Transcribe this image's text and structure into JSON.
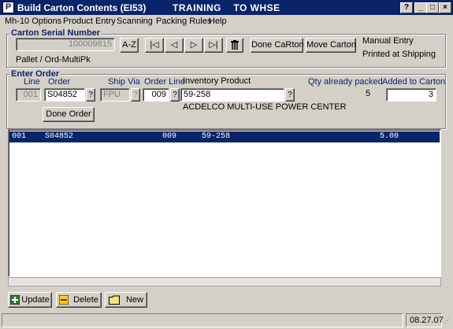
{
  "window": {
    "title": "Build Carton Contents (EI53)",
    "mode": "TRAINING    TO WHSE",
    "icon_letter": "P",
    "controls": {
      "help": "?",
      "minimize": "_",
      "maximize": "□",
      "close": "×"
    }
  },
  "menu": [
    "Mh-10 Options",
    "Product Entry",
    "Scanning",
    "Packing Rules",
    "Help"
  ],
  "carton": {
    "group_label": "Carton Serial Number",
    "serial": "100009815",
    "az_label": "A-Z",
    "nav": {
      "first": "|◁",
      "prev": "◁",
      "next": "▷",
      "last": "▷|",
      "delete": "trash-icon"
    },
    "done_label": "Done CaRton",
    "move_label": "Move Carton",
    "manual_entry": "Manual Entry",
    "printed_at": "Printed at Shipping",
    "pallet": "Pallet / Ord-MultiPk"
  },
  "order": {
    "group_label": "Enter Order",
    "headers": {
      "line": "Line",
      "order": "Order",
      "ship_via": "Ship Via",
      "order_line": "Order Line",
      "inventory_product": "Inventory Product",
      "qty_packed": "Qty already packed",
      "added": "Added to Carton"
    },
    "line": "001",
    "order_no": "S04852",
    "ship_via": "FPU",
    "order_line": "009",
    "product": "59-258",
    "qty_packed": "5",
    "added": "3",
    "description": "ACDELCO MULTI-USE POWER CENTER",
    "lookup": "?",
    "done_order_label": "Done Order"
  },
  "grid": {
    "rows": [
      {
        "line": "001",
        "order": "S04852",
        "order_line": "009",
        "product": "59-258",
        "qty": "5.00"
      }
    ]
  },
  "buttons": {
    "update": "Update",
    "delete": "Delete",
    "new": "New"
  },
  "status": {
    "date": "08.27.07"
  },
  "colors": {
    "title_bar": "#0a246a",
    "selection": "#0a246a",
    "face": "#d4d0c8"
  }
}
